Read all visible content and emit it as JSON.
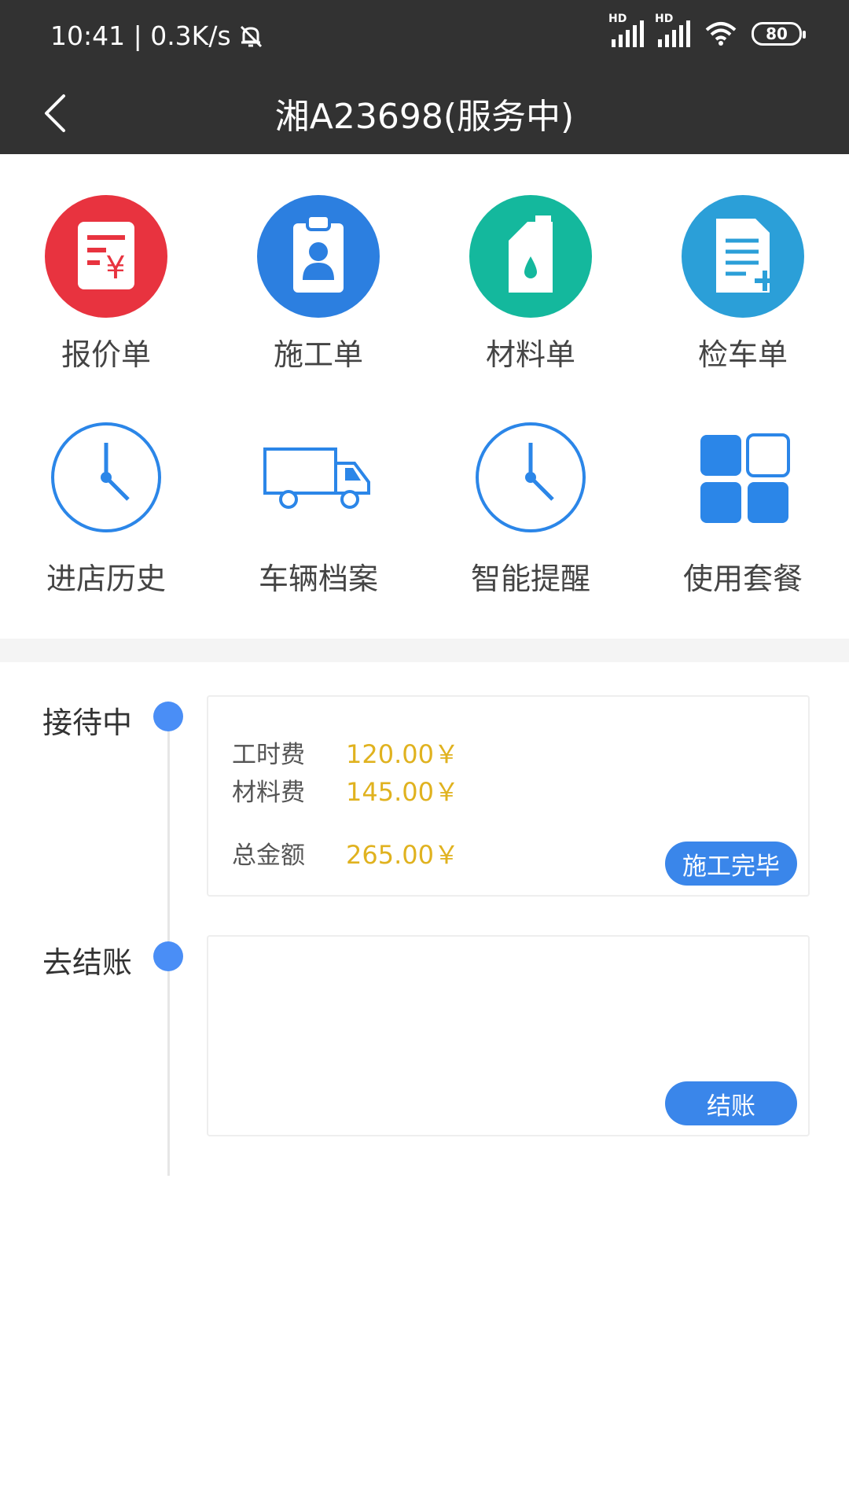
{
  "status_bar": {
    "time_speed": "10:41 | 0.3K/s",
    "signal1_hd": "HD",
    "signal2_hd": "HD",
    "battery": "80"
  },
  "header": {
    "title": "湘A23698(服务中)"
  },
  "menu": [
    {
      "label": "报价单",
      "icon": "quote-icon",
      "color": "#e8333f"
    },
    {
      "label": "施工单",
      "icon": "work-order-icon",
      "color": "#2c7fe0"
    },
    {
      "label": "材料单",
      "icon": "oil-can-icon",
      "color": "#14b89d"
    },
    {
      "label": "检车单",
      "icon": "document-add-icon",
      "color": "#2b9fd8"
    },
    {
      "label": "进店历史",
      "icon": "clock-icon",
      "color": "#2b86e8"
    },
    {
      "label": "车辆档案",
      "icon": "truck-icon",
      "color": "#2b86e8"
    },
    {
      "label": "智能提醒",
      "icon": "clock-icon",
      "color": "#2b86e8"
    },
    {
      "label": "使用套餐",
      "icon": "grid-icon",
      "color": "#2b86e8"
    }
  ],
  "timeline": {
    "step1": {
      "label": "接待中",
      "labor_label": "工时费",
      "labor_value": "120.00￥",
      "material_label": "材料费",
      "material_value": "145.00￥",
      "total_label": "总金额",
      "total_value": "265.00￥",
      "button": "施工完毕"
    },
    "step2": {
      "label": "去结账",
      "button": "结账"
    }
  },
  "colors": {
    "accent": "#3a86ea",
    "amount": "#e0b21f",
    "topbar": "#323232"
  }
}
